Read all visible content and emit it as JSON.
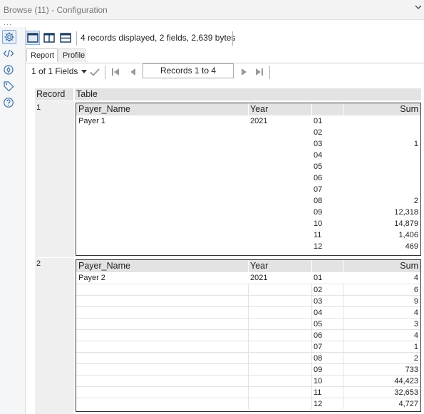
{
  "window": {
    "title": "Browse (11) - Configuration",
    "more": "..."
  },
  "sidebar": {
    "icons": [
      "gear-icon",
      "code-icon",
      "compass-icon",
      "tag-icon",
      "help-icon"
    ]
  },
  "toolbar": {
    "summary": "4 records displayed, 2 fields, 2,639 bytes"
  },
  "tabs": [
    {
      "label": "Report"
    },
    {
      "label": "Profile"
    }
  ],
  "nav": {
    "fields": "1 of 1 Fields",
    "records": "Records 1 to 4"
  },
  "grid": {
    "headers": {
      "record": "Record",
      "table": "Table"
    },
    "table_headers": {
      "payer": "Payer_Name",
      "year": "Year",
      "month": "",
      "sum": "Sum"
    },
    "records": [
      {
        "num": "1",
        "rows": [
          {
            "payer": "Payer 1",
            "year": "2021",
            "month": "01",
            "sum": ""
          },
          {
            "payer": "",
            "year": "",
            "month": "02",
            "sum": ""
          },
          {
            "payer": "",
            "year": "",
            "month": "03",
            "sum": "1"
          },
          {
            "payer": "",
            "year": "",
            "month": "04",
            "sum": ""
          },
          {
            "payer": "",
            "year": "",
            "month": "05",
            "sum": ""
          },
          {
            "payer": "",
            "year": "",
            "month": "06",
            "sum": ""
          },
          {
            "payer": "",
            "year": "",
            "month": "07",
            "sum": ""
          },
          {
            "payer": "",
            "year": "",
            "month": "08",
            "sum": "2"
          },
          {
            "payer": "",
            "year": "",
            "month": "09",
            "sum": "12,318"
          },
          {
            "payer": "",
            "year": "",
            "month": "10",
            "sum": "14,879"
          },
          {
            "payer": "",
            "year": "",
            "month": "11",
            "sum": "1,406"
          },
          {
            "payer": "",
            "year": "",
            "month": "12",
            "sum": "469"
          }
        ]
      },
      {
        "num": "2",
        "rows": [
          {
            "payer": "Payer 2",
            "year": "2021",
            "month": "01",
            "sum": "4"
          },
          {
            "payer": "",
            "year": "",
            "month": "02",
            "sum": "6"
          },
          {
            "payer": "",
            "year": "",
            "month": "03",
            "sum": "9"
          },
          {
            "payer": "",
            "year": "",
            "month": "04",
            "sum": "4"
          },
          {
            "payer": "",
            "year": "",
            "month": "05",
            "sum": "3"
          },
          {
            "payer": "",
            "year": "",
            "month": "06",
            "sum": "4"
          },
          {
            "payer": "",
            "year": "",
            "month": "07",
            "sum": "1"
          },
          {
            "payer": "",
            "year": "",
            "month": "08",
            "sum": "2"
          },
          {
            "payer": "",
            "year": "",
            "month": "09",
            "sum": "733"
          },
          {
            "payer": "",
            "year": "",
            "month": "10",
            "sum": "44,423"
          },
          {
            "payer": "",
            "year": "",
            "month": "11",
            "sum": "32,653"
          },
          {
            "payer": "",
            "year": "",
            "month": "12",
            "sum": "4,727"
          }
        ]
      }
    ]
  }
}
